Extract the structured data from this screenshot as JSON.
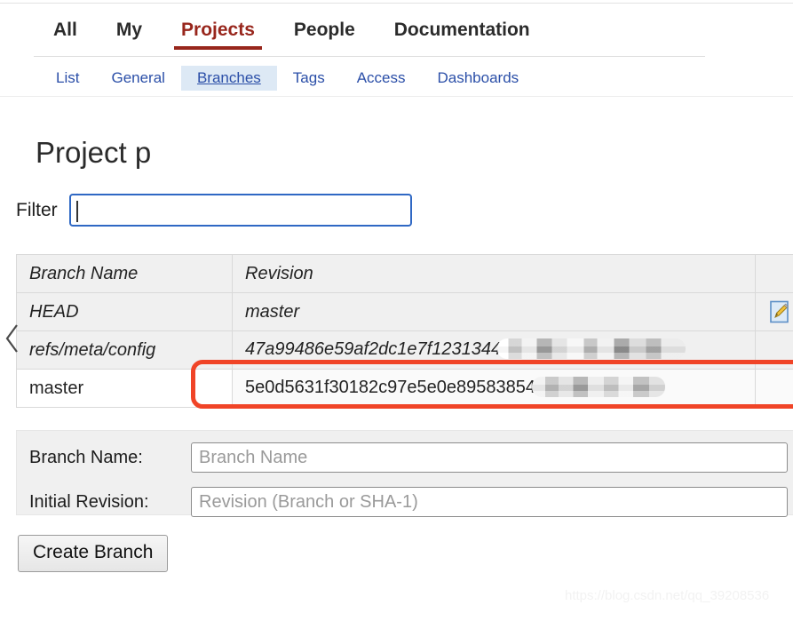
{
  "colors": {
    "active_tab": "#98261c",
    "link": "#2b4fa8",
    "subnav_active_bg": "#dde9f5",
    "annotation": "#f04427",
    "focus_border": "#2f68c4"
  },
  "primary_nav": {
    "items": [
      {
        "label": "All",
        "active": false
      },
      {
        "label": "My",
        "active": false
      },
      {
        "label": "Projects",
        "active": true
      },
      {
        "label": "People",
        "active": false
      },
      {
        "label": "Documentation",
        "active": false
      }
    ]
  },
  "secondary_nav": {
    "items": [
      {
        "label": "List",
        "active": false
      },
      {
        "label": "General",
        "active": false
      },
      {
        "label": "Branches",
        "active": true
      },
      {
        "label": "Tags",
        "active": false
      },
      {
        "label": "Access",
        "active": false
      },
      {
        "label": "Dashboards",
        "active": false
      }
    ]
  },
  "page": {
    "title_prefix": "Project p",
    "title_redacted": true
  },
  "filter": {
    "label": "Filter",
    "value": "",
    "placeholder": ""
  },
  "branches_table": {
    "columns": [
      "Branch Name",
      "Revision",
      "",
      ""
    ],
    "rows": [
      {
        "branch_name": "HEAD",
        "revision": "master",
        "revision_redacted": false,
        "has_edit_icon": true,
        "italic": true
      },
      {
        "branch_name": "refs/meta/config",
        "revision": "47a99486e59af2dc1e7f1231344",
        "revision_redacted": true,
        "has_edit_icon": false,
        "italic": true
      },
      {
        "branch_name": "master",
        "revision": "5e0d5631f30182c97e5e0e89583854",
        "revision_redacted": true,
        "has_edit_icon": false,
        "italic": false
      }
    ]
  },
  "create_branch_form": {
    "branch_name_label": "Branch Name:",
    "branch_name_value": "",
    "branch_name_placeholder": "Branch Name",
    "initial_revision_label": "Initial Revision:",
    "initial_revision_value": "",
    "initial_revision_placeholder": "Revision (Branch or SHA-1)",
    "submit_label": "Create Branch"
  },
  "icons": {
    "edit": "edit-pencil-icon",
    "collapse": "chevron-left-icon"
  },
  "watermark": {
    "text": "https://blog.csdn.net/qq_39208536"
  }
}
